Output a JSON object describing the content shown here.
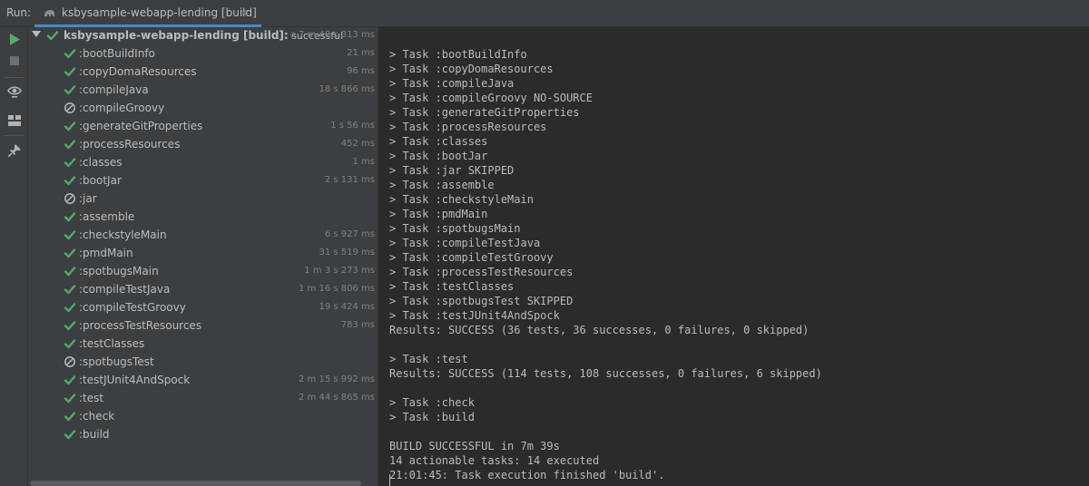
{
  "header": {
    "run_label": "Run:",
    "tab_title": "ksbysample-webapp-lending [build]",
    "tab_close": "×"
  },
  "toolbar": {
    "buttons": [
      {
        "name": "rerun-icon",
        "color": "#59a869"
      },
      {
        "name": "stop-icon",
        "color": "#6e6e6e"
      },
      {
        "name": "eye-icon",
        "color": "#afb1b3"
      },
      {
        "name": "layout-icon",
        "color": "#afb1b3"
      },
      {
        "name": "pin-icon",
        "color": "#afb1b3"
      }
    ]
  },
  "tree": {
    "root": {
      "name": "ksbysample-webapp-lending [build]:",
      "suffix": " successful",
      "duration": "a 7 m 40 s 313 ms",
      "status": "success"
    },
    "tasks": [
      {
        "name": ":bootBuildInfo",
        "duration": "21 ms",
        "status": "success"
      },
      {
        "name": ":copyDomaResources",
        "duration": "96 ms",
        "status": "success"
      },
      {
        "name": ":compileJava",
        "duration": "18 s 866 ms",
        "status": "success"
      },
      {
        "name": ":compileGroovy",
        "duration": "",
        "status": "skipped"
      },
      {
        "name": ":generateGitProperties",
        "duration": "1 s 56 ms",
        "status": "success"
      },
      {
        "name": ":processResources",
        "duration": "452 ms",
        "status": "success"
      },
      {
        "name": ":classes",
        "duration": "1 ms",
        "status": "success"
      },
      {
        "name": ":bootJar",
        "duration": "2 s 131 ms",
        "status": "success"
      },
      {
        "name": ":jar",
        "duration": "",
        "status": "skipped"
      },
      {
        "name": ":assemble",
        "duration": "",
        "status": "success"
      },
      {
        "name": ":checkstyleMain",
        "duration": "6 s 927 ms",
        "status": "success"
      },
      {
        "name": ":pmdMain",
        "duration": "31 s 519 ms",
        "status": "success"
      },
      {
        "name": ":spotbugsMain",
        "duration": "1 m 3 s 273 ms",
        "status": "success"
      },
      {
        "name": ":compileTestJava",
        "duration": "1 m 16 s 806 ms",
        "status": "success"
      },
      {
        "name": ":compileTestGroovy",
        "duration": "19 s 424 ms",
        "status": "success"
      },
      {
        "name": ":processTestResources",
        "duration": "783 ms",
        "status": "success"
      },
      {
        "name": ":testClasses",
        "duration": "",
        "status": "success"
      },
      {
        "name": ":spotbugsTest",
        "duration": "",
        "status": "skipped"
      },
      {
        "name": ":testJUnit4AndSpock",
        "duration": "2 m 15 s 992 ms",
        "status": "success"
      },
      {
        "name": ":test",
        "duration": "2 m 44 s 865 ms",
        "status": "success"
      },
      {
        "name": ":check",
        "duration": "",
        "status": "success"
      },
      {
        "name": ":build",
        "duration": "",
        "status": "success"
      }
    ]
  },
  "console": {
    "lines": [
      "",
      "> Task :bootBuildInfo",
      "> Task :copyDomaResources",
      "> Task :compileJava",
      "> Task :compileGroovy NO-SOURCE",
      "> Task :generateGitProperties",
      "> Task :processResources",
      "> Task :classes",
      "> Task :bootJar",
      "> Task :jar SKIPPED",
      "> Task :assemble",
      "> Task :checkstyleMain",
      "> Task :pmdMain",
      "> Task :spotbugsMain",
      "> Task :compileTestJava",
      "> Task :compileTestGroovy",
      "> Task :processTestResources",
      "> Task :testClasses",
      "> Task :spotbugsTest SKIPPED",
      "> Task :testJUnit4AndSpock",
      "Results: SUCCESS (36 tests, 36 successes, 0 failures, 0 skipped)",
      "",
      "> Task :test",
      "Results: SUCCESS (114 tests, 108 successes, 0 failures, 6 skipped)",
      "",
      "> Task :check",
      "> Task :build",
      "",
      "BUILD SUCCESSFUL in 7m 39s",
      "14 actionable tasks: 14 executed",
      "21:01:45: Task execution finished 'build'."
    ]
  },
  "colors": {
    "success": "#59a869",
    "skipped": "#afb1b3",
    "tab_underline": "#4a88c7"
  }
}
